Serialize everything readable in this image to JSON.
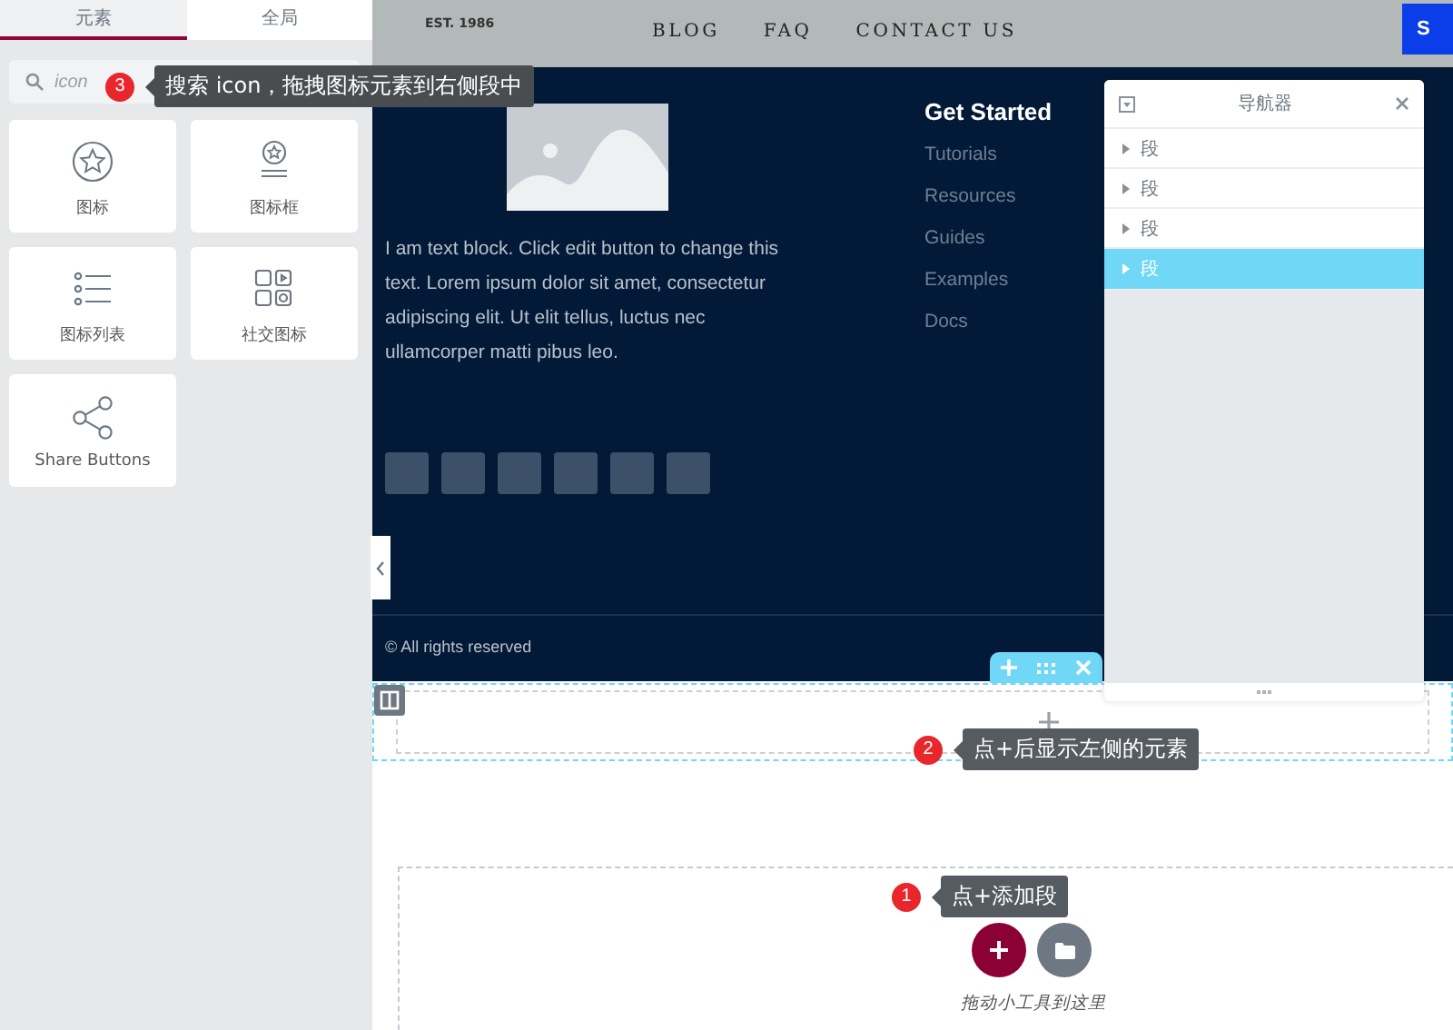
{
  "sidebar": {
    "tabs": [
      {
        "label": "元素",
        "selected": true
      },
      {
        "label": "全局",
        "selected": false
      }
    ],
    "search": {
      "value": "icon"
    },
    "widgets": [
      {
        "label": "图标",
        "kind": "icon"
      },
      {
        "label": "图标框",
        "kind": "icon_box"
      },
      {
        "label": "图标列表",
        "kind": "icon_list"
      },
      {
        "label": "社交图标",
        "kind": "social_icons"
      },
      {
        "label": "Share Buttons",
        "kind": "share_buttons"
      }
    ]
  },
  "header": {
    "tagline": "EST. 1986",
    "nav": [
      "BLOG",
      "FAQ",
      "CONTACT US"
    ],
    "button": "S"
  },
  "footer_section": {
    "text": "I am text block. Click edit button to change this text. Lorem ipsum dolor sit amet, consectetur adipiscing elit. Ut elit tellus, luctus nec ullamcorper matti pibus leo.",
    "menu": {
      "title": "Get Started",
      "links": [
        "Tutorials",
        "Resources",
        "Guides",
        "Examples",
        "Docs"
      ]
    },
    "copyright": "© All rights reserved"
  },
  "navigator": {
    "title": "导航器",
    "items": [
      {
        "label": "段",
        "selected": false
      },
      {
        "label": "段",
        "selected": false
      },
      {
        "label": "段",
        "selected": false
      },
      {
        "label": "段",
        "selected": true
      }
    ]
  },
  "drop_zone": {
    "hint": "拖动小工具到这里"
  },
  "tooltips": [
    {
      "number": "3",
      "text": "搜索 icon，拖拽图标元素到右侧段中"
    },
    {
      "number": "2",
      "text": "点+后显示左侧的元素"
    },
    {
      "number": "1",
      "text": "点+添加段"
    }
  ]
}
